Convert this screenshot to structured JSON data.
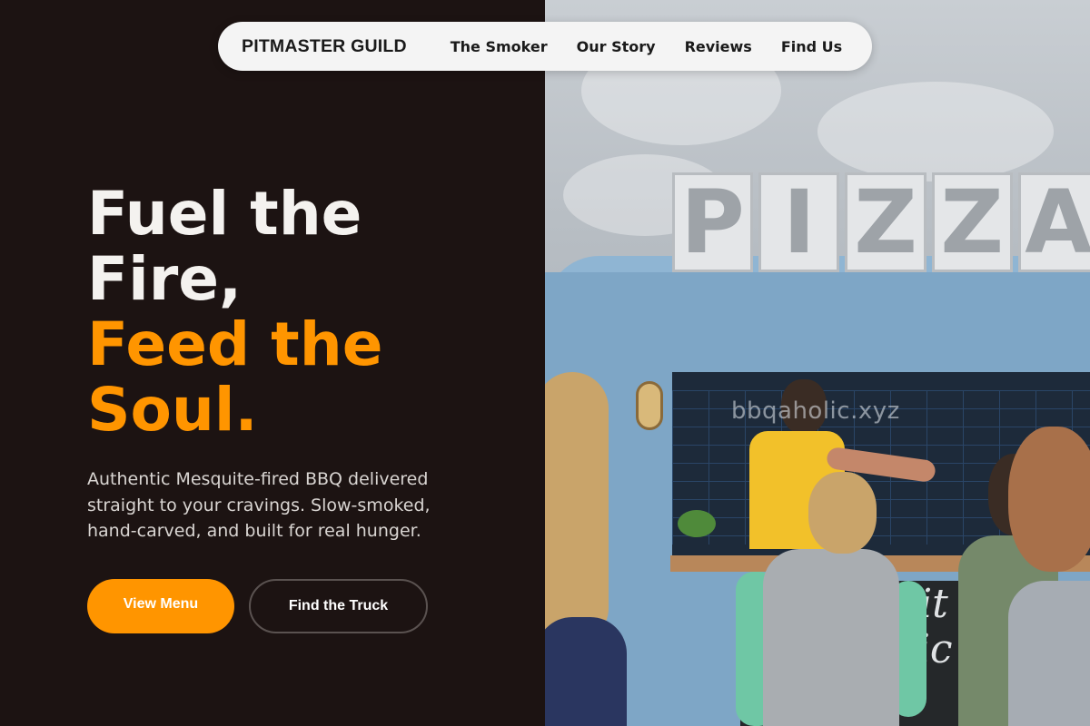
{
  "nav": {
    "brand": "PITMASTER GUILD",
    "links": [
      {
        "label": "The Smoker"
      },
      {
        "label": "Our Story"
      },
      {
        "label": "Reviews"
      },
      {
        "label": "Find Us"
      }
    ]
  },
  "hero": {
    "title_line1": "Fuel the",
    "title_line2": "Fire,",
    "title_accent_line1": "Feed the",
    "title_accent_line2": "Soul.",
    "subtitle": "Authentic Mesquite-fired BBQ delivered straight to your cravings. Slow-smoked, hand-carved, and built for real hunger.",
    "primary_button": "View Menu",
    "secondary_button": "Find the Truck"
  },
  "photo": {
    "sign_letters": [
      "P",
      "I",
      "Z",
      "Z",
      "A"
    ],
    "watermark": "bbqaholic.xyz",
    "chalkboard_text": "erit\nonic"
  },
  "colors": {
    "accent": "#ff9500",
    "background": "#1c1312",
    "nav_bg": "#f4f4f4",
    "truck_blue": "#7ea6c6"
  }
}
